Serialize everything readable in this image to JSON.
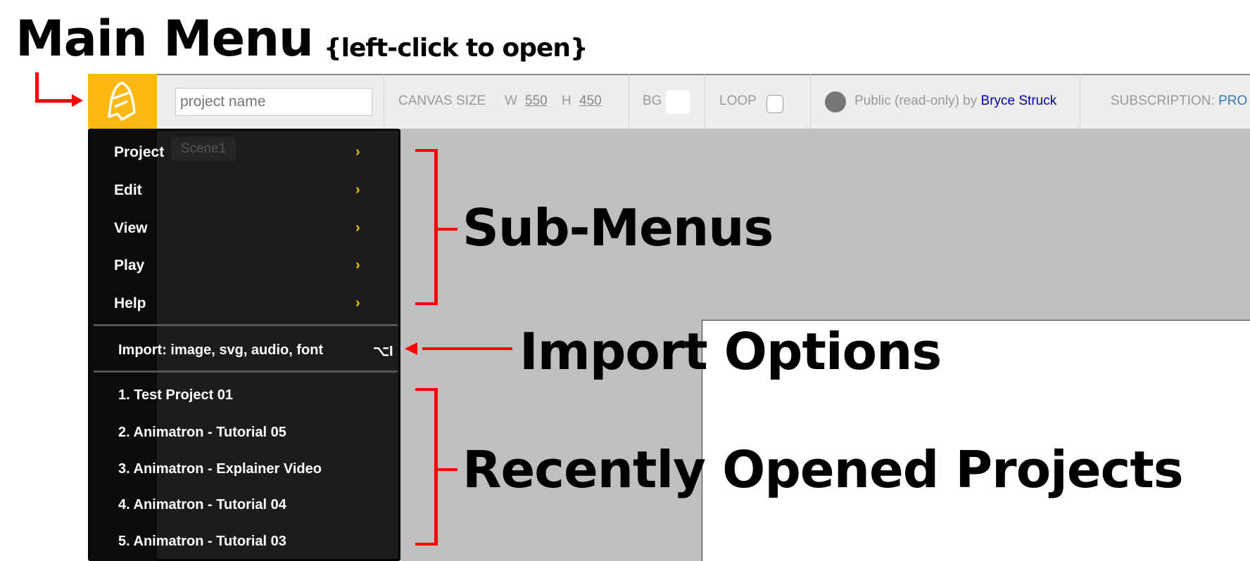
{
  "annotations": {
    "main_menu": "Main Menu",
    "main_menu_hint": "{left-click to open}",
    "sub_menus": "Sub-Menus",
    "import_options": "Import Options",
    "recent": "Recently Opened Projects"
  },
  "toolbar": {
    "project_name_placeholder": "project name",
    "canvas_size_label": "CANVAS SIZE",
    "w_label": "W",
    "w_value": "550",
    "h_label": "H",
    "h_value": "450",
    "bg_label": "BG",
    "loop_label": "LOOP",
    "public_text": "Public (read-only) by",
    "author": "Bryce Struck",
    "subscription_label": "SUBSCRIPTION:",
    "subscription_value": "PRO"
  },
  "scene_tab": "Scene1",
  "menu": {
    "submenus": [
      "Project",
      "Edit",
      "View",
      "Play",
      "Help"
    ],
    "import_label": "Import: image, svg, audio, font",
    "import_shortcut": "⌥I",
    "recent": [
      "1. Test Project 01",
      "2. Animatron - Tutorial 05",
      "3. Animatron - Explainer Video",
      "4. Animatron - Tutorial 04",
      "5. Animatron - Tutorial 03"
    ]
  },
  "colors": {
    "logo_bg": "#fdb813",
    "chevron": "#f5c800",
    "author_link": "#0000aa",
    "subscription": "#3a78b5",
    "annotation_arrow": "#ff0000"
  }
}
